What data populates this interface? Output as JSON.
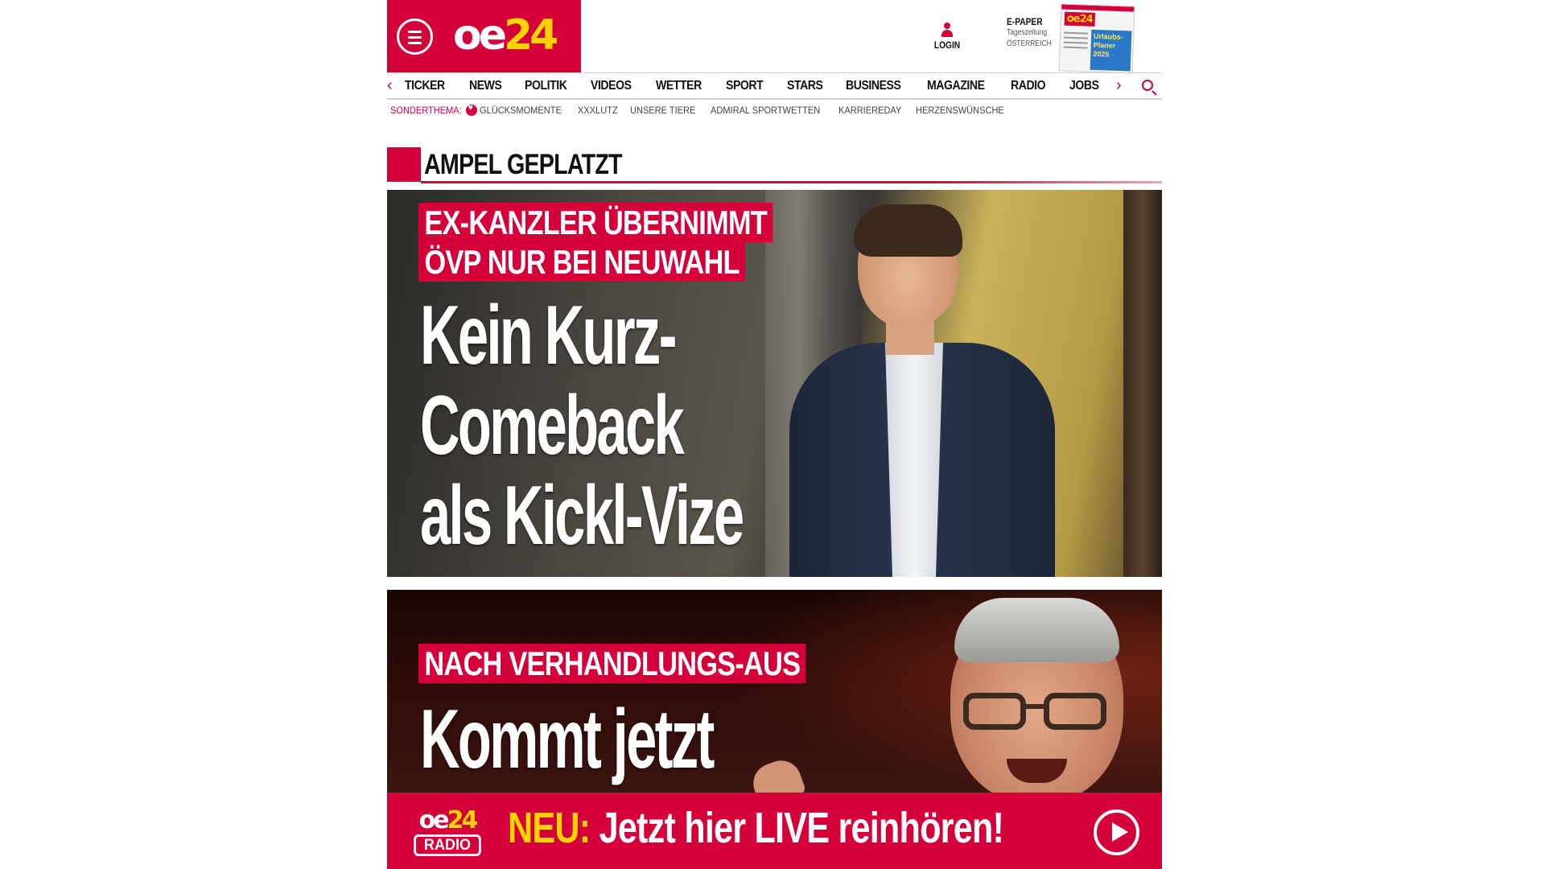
{
  "brand": {
    "logo_oe": "oe",
    "logo_num": "24"
  },
  "header": {
    "login_label": "LOGIN",
    "epaper_title": "E-PAPER",
    "epaper_sub1": "Tageszeitung",
    "epaper_sub2": "ÖSTERREICH",
    "cover_logo": "oe24",
    "cover_promo": "Urlaubs-Planer 2025"
  },
  "nav": {
    "prev_label": "‹",
    "next_label": "›",
    "items": [
      "TICKER",
      "NEWS",
      "POLITIK",
      "VIDEOS",
      "WETTER",
      "SPORT",
      "STARS",
      "BUSINESS",
      "MAGAZINE",
      "RADIO",
      "JOBS"
    ]
  },
  "subnav": {
    "label": "SONDERTHEMA:",
    "items": [
      "GLÜCKSMOMENTE",
      "XXXLUTZ",
      "UNSERE TIERE",
      "ADMIRAL SPORTWETTEN",
      "KARRIEREDAY",
      "HERZENSWÜNSCHE"
    ]
  },
  "section": {
    "title": "AMPEL GEPLATZT"
  },
  "stories": [
    {
      "kicker_lines": [
        "EX-KANZLER ÜBERNIMMT",
        "ÖVP NUR BEI NEUWAHL"
      ],
      "headline_lines": [
        "Kein Kurz-",
        "Comeback",
        "als Kickl-Vize"
      ]
    },
    {
      "kicker_lines": [
        "NACH VERHANDLUNGS-AUS"
      ],
      "headline_lines": [
        "Kommt jetzt"
      ]
    }
  ],
  "radio_banner": {
    "logo_oe": "oe",
    "logo_num": "24",
    "logo_radio": "RADIO",
    "neu": "NEU:",
    "message": " Jetzt hier LIVE reinhören!"
  },
  "colors": {
    "brand_red": "#d4003a",
    "brand_yellow": "#ffd200"
  }
}
